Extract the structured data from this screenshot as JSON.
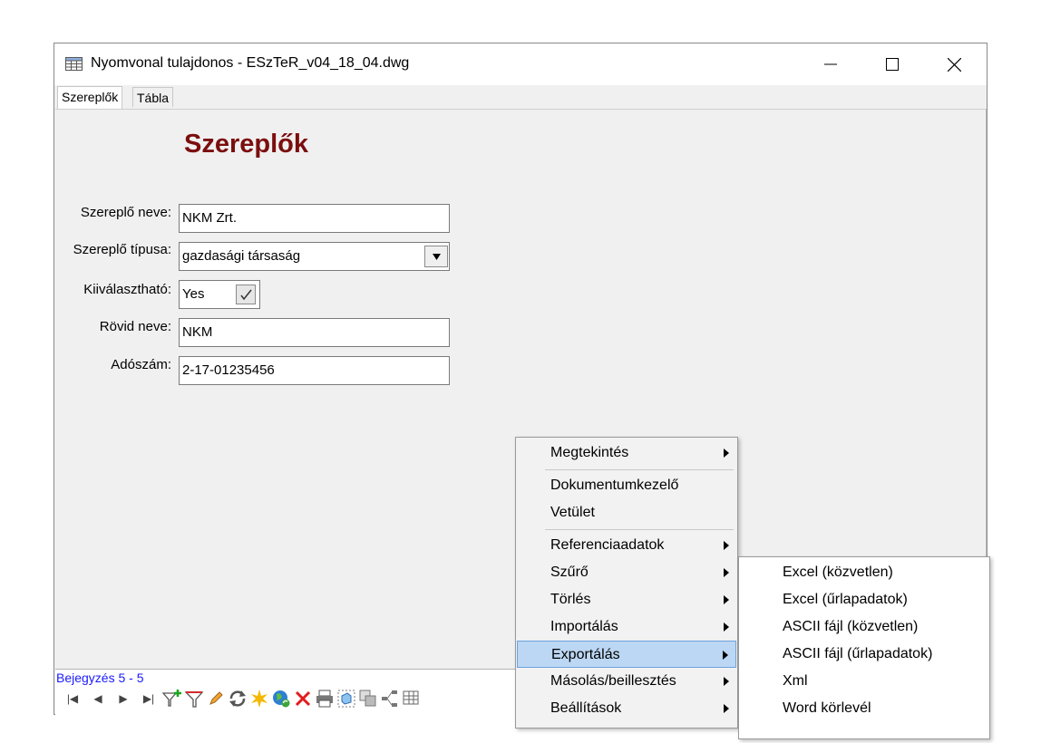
{
  "window": {
    "title": "Nyomvonal tulajdonos - ESzTeR_v04_18_04.dwg"
  },
  "tabs": [
    {
      "label": "Szereplők",
      "active": true
    },
    {
      "label": "Tábla",
      "active": false
    }
  ],
  "form": {
    "heading": "Szereplők",
    "fields": [
      {
        "label": "Szereplő neve:",
        "value": "NKM Zrt."
      },
      {
        "label": "Szereplő típusa:",
        "value": "gazdasági társaság"
      },
      {
        "label": "Kiiválasztható:",
        "value": "Yes"
      },
      {
        "label": "Rövid neve:",
        "value": "NKM"
      },
      {
        "label": "Adószám:",
        "value": "2-17-01235456"
      }
    ]
  },
  "status": {
    "record_text": "Bejegyzés 5 - 5"
  },
  "context_menu": {
    "items": [
      {
        "label": "Megtekintés",
        "submenu": true
      },
      {
        "label": "Dokumentumkezelő",
        "submenu": false
      },
      {
        "label": "Vetület",
        "submenu": false
      },
      {
        "label": "Referenciaadatok",
        "submenu": true
      },
      {
        "label": "Szűrő",
        "submenu": true
      },
      {
        "label": "Törlés",
        "submenu": true
      },
      {
        "label": "Importálás",
        "submenu": true
      },
      {
        "label": "Exportálás",
        "submenu": true,
        "highlighted": true
      },
      {
        "label": "Másolás/beillesztés",
        "submenu": true
      },
      {
        "label": "Beállítások",
        "submenu": true
      }
    ]
  },
  "export_submenu": {
    "items": [
      {
        "label": "Excel (közvetlen)"
      },
      {
        "label": "Excel (űrlapadatok)"
      },
      {
        "label": "ASCII fájl (közvetlen)"
      },
      {
        "label": "ASCII fájl (űrlapadatok)"
      },
      {
        "label": "Xml"
      },
      {
        "label": "Word körlevél"
      }
    ]
  },
  "colors": {
    "heading": "#7b0e0e",
    "record_text": "#1a1aff",
    "menu_highlight": "#bcd7f3"
  },
  "icons": [
    "table-icon",
    "minimize-icon",
    "maximize-icon",
    "close-icon",
    "first-record-icon",
    "previous-record-icon",
    "next-record-icon",
    "last-record-icon",
    "add-filter-icon",
    "filter-icon",
    "pencil-icon",
    "refresh-icon",
    "star-icon",
    "globe-icon",
    "delete-icon",
    "print-icon",
    "select-icon",
    "copy-icon",
    "network-icon",
    "grid-icon"
  ]
}
